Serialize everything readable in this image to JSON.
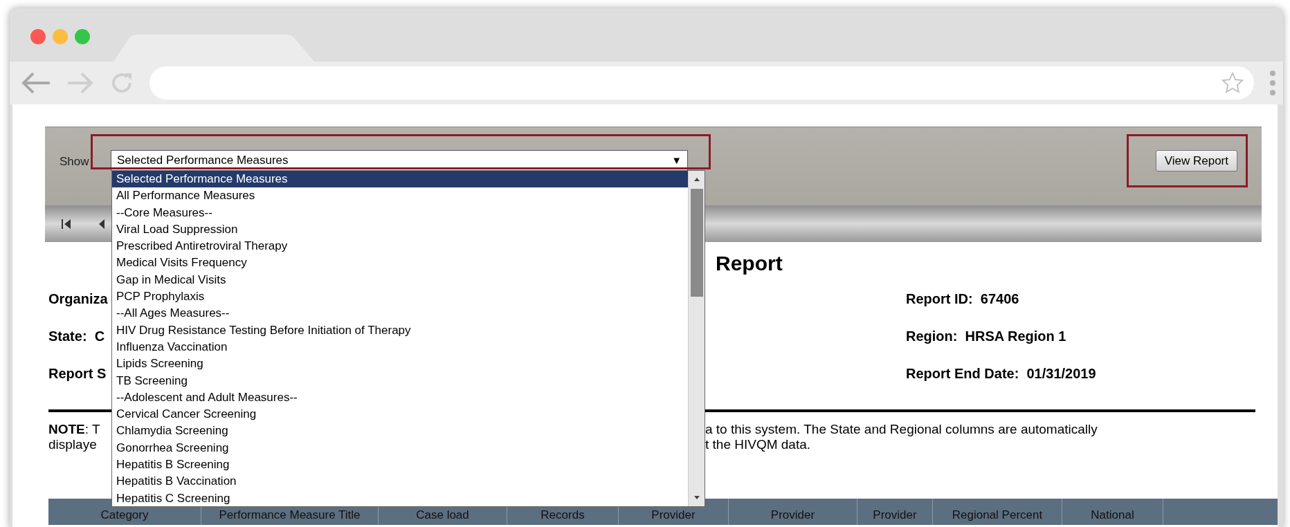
{
  "toolbar": {
    "show_label": "Show",
    "select_value": "Selected Performance Measures",
    "select_arrow": "▼",
    "view_report_button": "View Report"
  },
  "dropdown": {
    "options": [
      {
        "label": "Selected Performance Measures",
        "selected": true
      },
      {
        "label": "All Performance Measures",
        "selected": false
      },
      {
        "label": "--Core Measures--",
        "selected": false
      },
      {
        "label": "Viral Load Suppression",
        "selected": false
      },
      {
        "label": "Prescribed Antiretroviral Therapy",
        "selected": false
      },
      {
        "label": "Medical Visits Frequency",
        "selected": false
      },
      {
        "label": "Gap in Medical Visits",
        "selected": false
      },
      {
        "label": "PCP Prophylaxis",
        "selected": false
      },
      {
        "label": "--All Ages Measures--",
        "selected": false
      },
      {
        "label": "HIV Drug Resistance Testing Before Initiation of Therapy",
        "selected": false
      },
      {
        "label": "Influenza Vaccination",
        "selected": false
      },
      {
        "label": "Lipids Screening",
        "selected": false
      },
      {
        "label": "TB Screening",
        "selected": false
      },
      {
        "label": "--Adolescent and Adult Measures--",
        "selected": false
      },
      {
        "label": "Cervical Cancer Screening",
        "selected": false
      },
      {
        "label": "Chlamydia Screening",
        "selected": false
      },
      {
        "label": "Gonorrhea Screening",
        "selected": false
      },
      {
        "label": "Hepatitis B Screening",
        "selected": false
      },
      {
        "label": "Hepatitis B Vaccination",
        "selected": false
      },
      {
        "label": "Hepatitis C Screening",
        "selected": false
      }
    ]
  },
  "report": {
    "title": "Report",
    "left_fields": [
      "Organiza",
      "State:  C",
      "Report S"
    ],
    "right_fields": [
      {
        "label": "Report ID:",
        "value": "67406"
      },
      {
        "label": "Region:",
        "value": "HRSA Region 1"
      },
      {
        "label": "Report End Date:",
        "value": "01/31/2019"
      }
    ]
  },
  "note": {
    "lines": [
      {
        "left": "**NOTE**: T",
        "right": "a to this system. The State and Regional columns are automatically"
      },
      {
        "left": "displaye",
        "right": "t the HIVQM data."
      }
    ]
  },
  "table": {
    "columns": [
      "Category",
      "Performance Measure Title",
      "Case load",
      "Records",
      "Provider",
      "Provider",
      "Provider",
      "Regional Percent",
      "National"
    ]
  }
}
